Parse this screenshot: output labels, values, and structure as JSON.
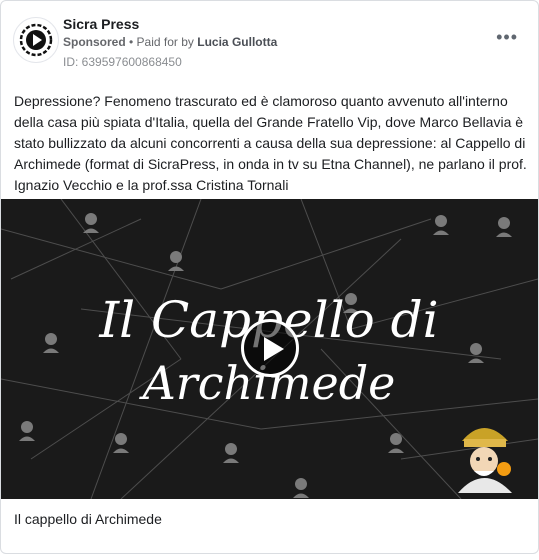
{
  "page": {
    "name": "Sicra Press",
    "sponsored": "Sponsored",
    "paid_for_prefix": "• Paid for by",
    "payer": "Lucia Gullotta",
    "ad_id": "ID: 639597600868450",
    "more_glyph": "•••"
  },
  "post": {
    "text": "Depressione? Fenomeno trascurato ed è clamoroso quanto avvenuto all'interno della casa più spiata d'Italia, quella del Grande Fratello Vip, dove Marco Bellavia è stato bullizzato da alcuni concorrenti a causa della sua depressione: al Cappello di Archimede (format di SicraPress, in onda in tv su Etna Channel), ne parlano il prof. Ignazio Vecchio e la prof.ssa Cristina Tornali"
  },
  "video": {
    "title_line1": "Il Cappello di",
    "title_line2": "Archimede",
    "caption": "Il cappello di Archimede"
  },
  "colors": {
    "accent": "#1877f2",
    "media_bg": "#1a1a1a"
  },
  "icons": {
    "logo": "sicra-press-logo-icon",
    "play": "play-icon",
    "more": "more-options-icon"
  }
}
